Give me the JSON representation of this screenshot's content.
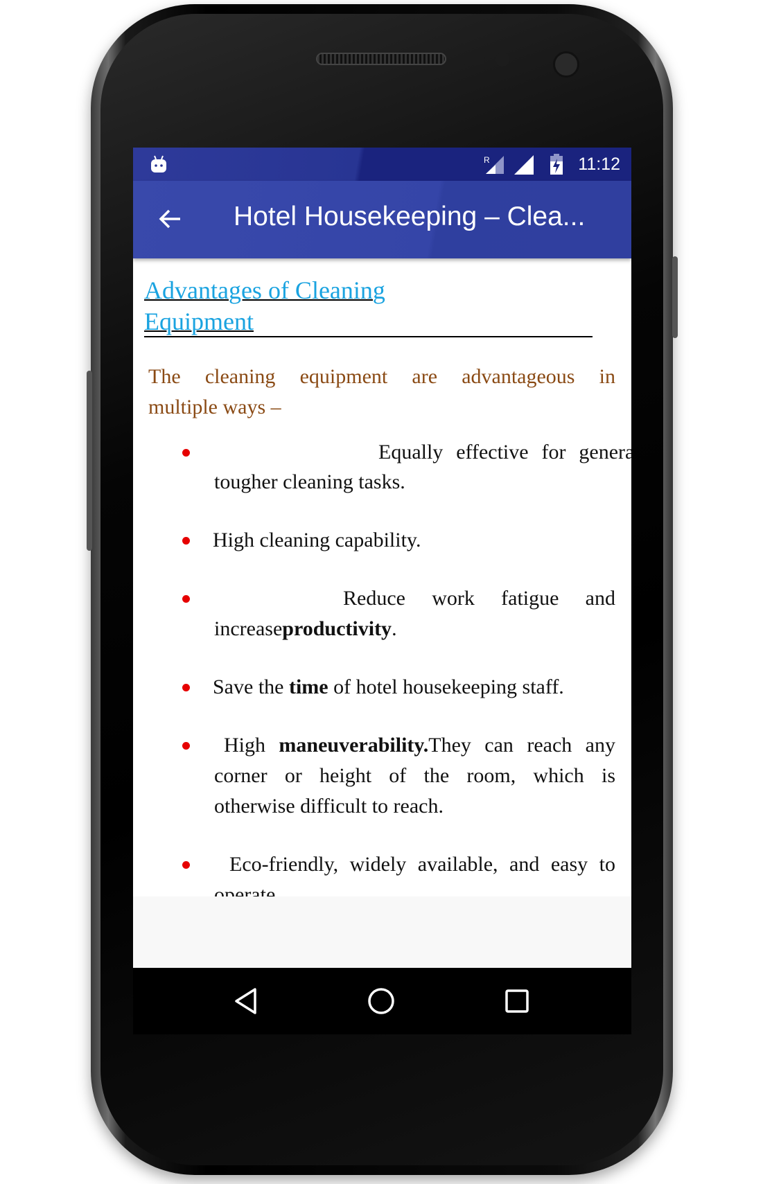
{
  "status_bar": {
    "time": "11:12",
    "icons": [
      "android-debug-icon",
      "roaming-signal-icon",
      "signal-icon",
      "battery-charging-icon"
    ]
  },
  "app_bar": {
    "title": "Hotel Housekeeping – Clea...",
    "back_icon": "arrow-left-icon"
  },
  "article": {
    "heading_line1": "Advantages of Cleaning",
    "heading_line2": "Equipment",
    "intro_line1": "The cleaning equipment are advantageous in",
    "intro_line2": "multiple ways –",
    "bullets": [
      {
        "l1": "Equally effective for general as well as",
        "l2": "tougher cleaning tasks."
      },
      {
        "l1": "High cleaning capability."
      },
      {
        "l1": "Reduce work fatigue and",
        "l2a": "increase",
        "l2b": "productivity",
        "l2c": "."
      },
      {
        "a": "Save the ",
        "b": "time",
        "c": " of hotel housekeeping staff."
      },
      {
        "a": "High ",
        "b": "maneuverability.",
        "c": "They can reach any",
        "l2": "corner or height of the room, which is",
        "l3": "otherwise difficult to reach."
      },
      {
        "l1": "Eco-friendly, widely available, and easy to",
        "l2": "operate"
      }
    ]
  },
  "nav_bar": {
    "icons": [
      "back-triangle-icon",
      "home-circle-icon",
      "recents-square-icon"
    ]
  },
  "colors": {
    "app_bar": "#3949ab",
    "status_bar": "#1a237e",
    "heading": "#1aa3e0",
    "intro": "#8a4a14",
    "bullet": "#e60000"
  }
}
